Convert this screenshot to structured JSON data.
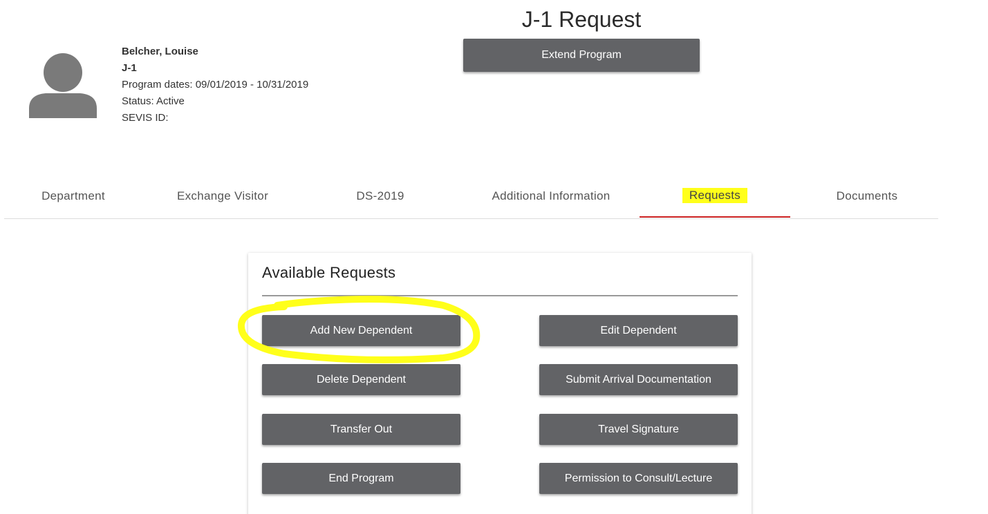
{
  "header": {
    "title": "J-1 Request",
    "extend_button": "Extend Program"
  },
  "profile": {
    "name": "Belcher, Louise",
    "visa": "J-1",
    "program_dates": "Program dates: 09/01/2019 - 10/31/2019",
    "status": "Status: Active",
    "sevis": "SEVIS ID:"
  },
  "tabs": [
    {
      "label": "Department"
    },
    {
      "label": "Exchange Visitor"
    },
    {
      "label": "DS-2019"
    },
    {
      "label": "Additional Information"
    },
    {
      "label": "Requests"
    },
    {
      "label": "Documents"
    }
  ],
  "active_tab": "Requests",
  "card": {
    "title": "Available Requests",
    "buttons": [
      {
        "label": "Add New Dependent"
      },
      {
        "label": "Edit Dependent"
      },
      {
        "label": "Delete Dependent"
      },
      {
        "label": "Submit Arrival Documentation"
      },
      {
        "label": "Transfer Out"
      },
      {
        "label": "Travel Signature"
      },
      {
        "label": "End Program"
      },
      {
        "label": "Permission to Consult/Lecture"
      }
    ]
  },
  "colors": {
    "button": "#626366",
    "active_tab_underline": "#cc2222",
    "highlight": "#ffff1a"
  }
}
